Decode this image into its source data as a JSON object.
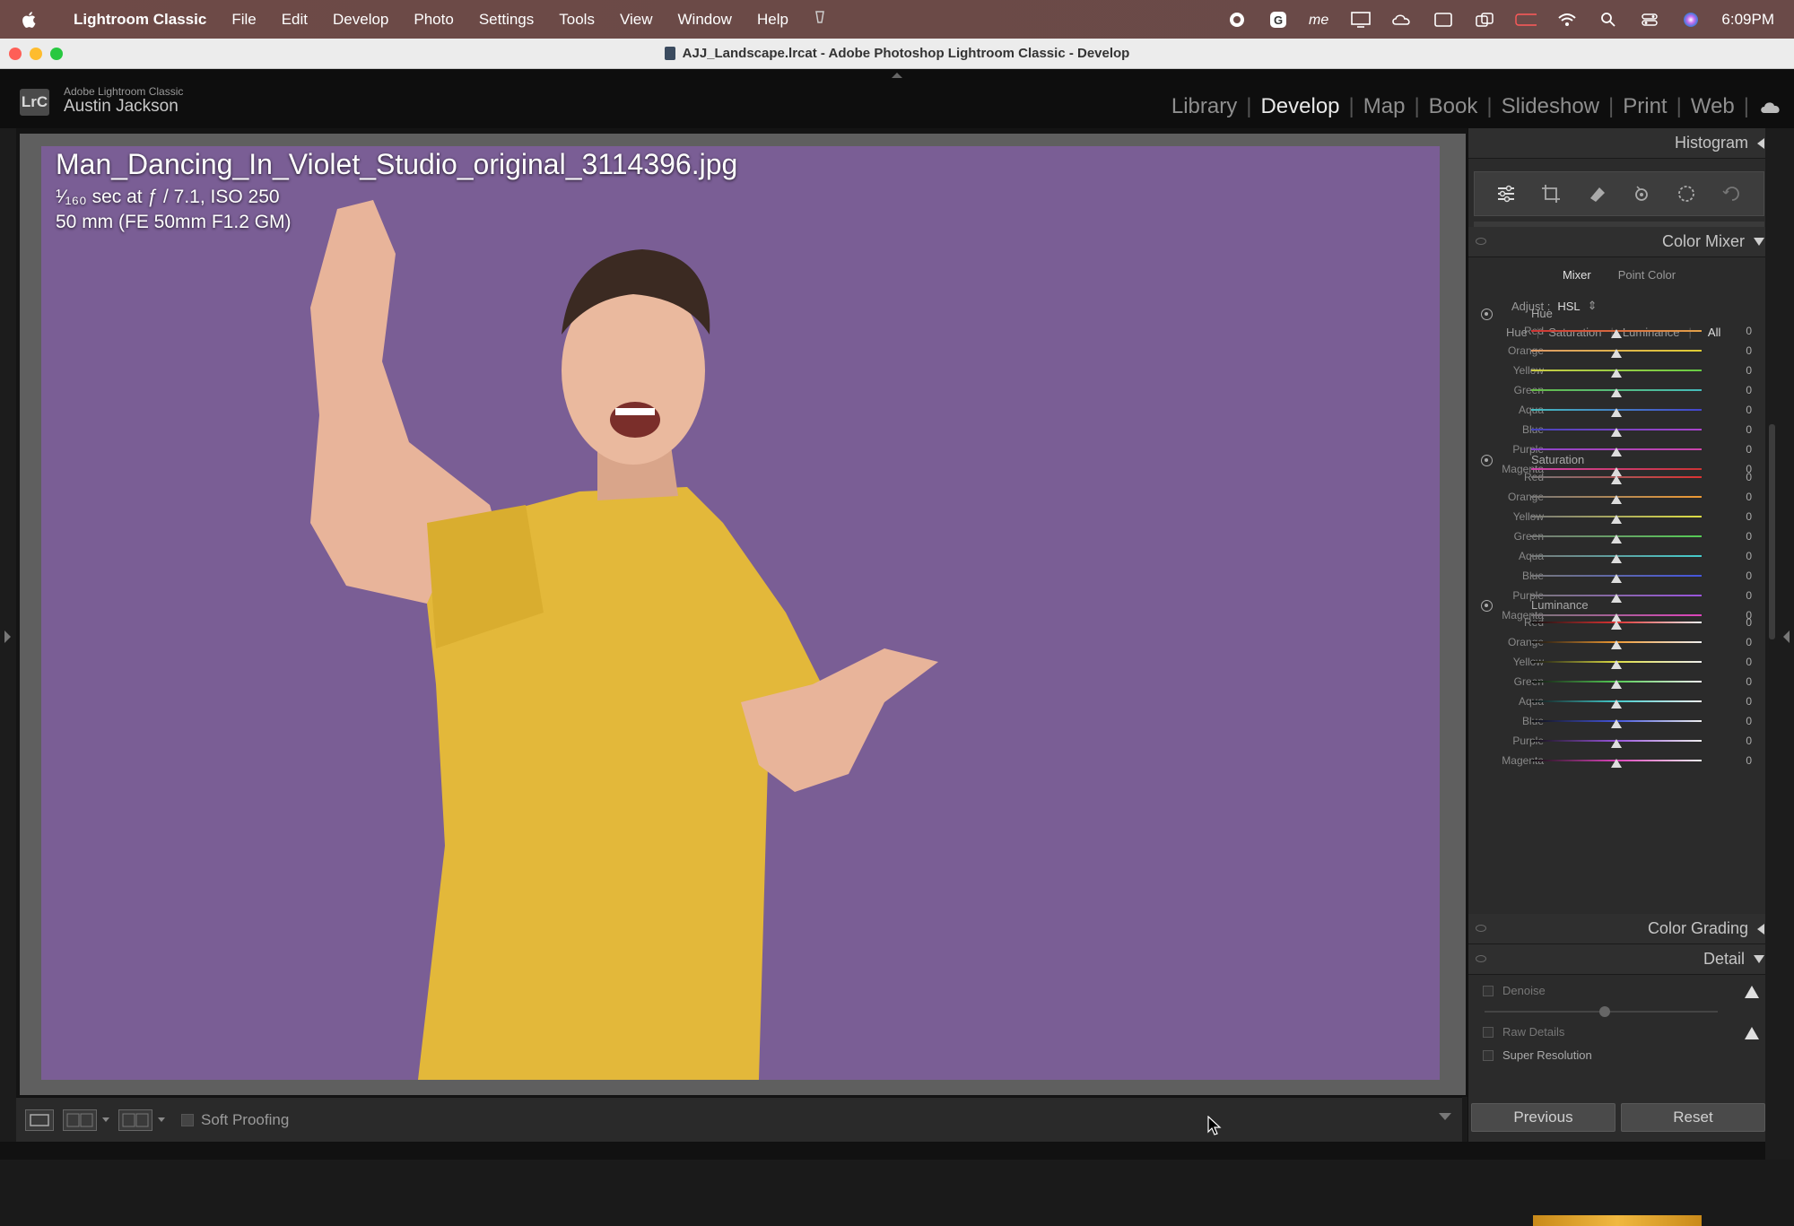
{
  "menubar": {
    "app_name": "Lightroom Classic",
    "items": [
      "File",
      "Edit",
      "Develop",
      "Photo",
      "Settings",
      "Tools",
      "View",
      "Window",
      "Help"
    ],
    "clock": "6:09PM",
    "status_icons": [
      "record-icon",
      "grammarly-icon",
      "me-icon",
      "display-icon",
      "creative-cloud-icon",
      "window-icon",
      "overlap-icon",
      "battery-icon",
      "wifi-icon",
      "search-icon",
      "control-center-icon",
      "siri-icon"
    ]
  },
  "window": {
    "title": "AJJ_Landscape.lrcat - Adobe Photoshop Lightroom Classic - Develop"
  },
  "identity": {
    "badge": "LrC",
    "product": "Adobe Lightroom Classic",
    "user": "Austin Jackson"
  },
  "modules": {
    "items": [
      "Library",
      "Develop",
      "Map",
      "Book",
      "Slideshow",
      "Print",
      "Web"
    ],
    "active": "Develop"
  },
  "photo": {
    "filename": "Man_Dancing_In_Violet_Studio_original_3114396.jpg",
    "exposure": "¹⁄₁₆₀ sec at ƒ / 7.1, ISO 250",
    "lens": "50 mm (FE 50mm F1.2 GM)",
    "background_color": "#7a5e95"
  },
  "toolbar": {
    "soft_proofing": "Soft Proofing"
  },
  "panels": {
    "histogram": "Histogram",
    "color_mixer": "Color Mixer",
    "color_grading": "Color Grading",
    "detail": "Detail"
  },
  "mixer": {
    "tabs": [
      "Mixer",
      "Point Color"
    ],
    "adjust_label": "Adjust :",
    "adjust_value": "HSL",
    "modes": [
      "Hue",
      "Saturation",
      "Luminance",
      "All"
    ],
    "active_mode": "All",
    "groups": [
      {
        "title": "Hue",
        "sliders": [
          {
            "label": "Red",
            "value": "0"
          },
          {
            "label": "Orange",
            "value": "0"
          },
          {
            "label": "Yellow",
            "value": "0"
          },
          {
            "label": "Green",
            "value": "0"
          },
          {
            "label": "Aqua",
            "value": "0"
          },
          {
            "label": "Blue",
            "value": "0"
          },
          {
            "label": "Purple",
            "value": "0"
          },
          {
            "label": "Magenta",
            "value": "0"
          }
        ]
      },
      {
        "title": "Saturation",
        "sliders": [
          {
            "label": "Red",
            "value": "0"
          },
          {
            "label": "Orange",
            "value": "0"
          },
          {
            "label": "Yellow",
            "value": "0"
          },
          {
            "label": "Green",
            "value": "0"
          },
          {
            "label": "Aqua",
            "value": "0"
          },
          {
            "label": "Blue",
            "value": "0"
          },
          {
            "label": "Purple",
            "value": "0"
          },
          {
            "label": "Magenta",
            "value": "0"
          }
        ]
      },
      {
        "title": "Luminance",
        "sliders": [
          {
            "label": "Red",
            "value": "0"
          },
          {
            "label": "Orange",
            "value": "0"
          },
          {
            "label": "Yellow",
            "value": "0"
          },
          {
            "label": "Green",
            "value": "0"
          },
          {
            "label": "Aqua",
            "value": "0"
          },
          {
            "label": "Blue",
            "value": "0"
          },
          {
            "label": "Purple",
            "value": "0"
          },
          {
            "label": "Magenta",
            "value": "0"
          }
        ]
      }
    ]
  },
  "detail": {
    "denoise": "Denoise",
    "raw_details": "Raw Details",
    "super_resolution": "Super Resolution"
  },
  "footer": {
    "previous": "Previous",
    "reset": "Reset"
  }
}
